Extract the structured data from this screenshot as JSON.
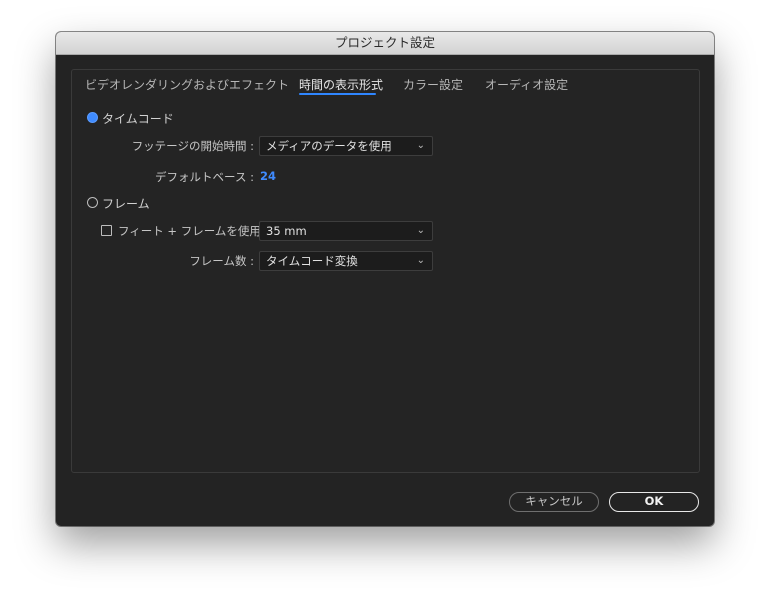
{
  "window": {
    "title": "プロジェクト設定"
  },
  "tabs": [
    {
      "label": "ビデオレンダリングおよびエフェクト",
      "active": false
    },
    {
      "label": "時間の表示形式",
      "active": true
    },
    {
      "label": "カラー設定",
      "active": false
    },
    {
      "label": "オーディオ設定",
      "active": false
    }
  ],
  "timecode": {
    "label": "タイムコード",
    "selected": true,
    "footage_start_label": "フッテージの開始時間 :",
    "footage_start_value": "メディアのデータを使用",
    "default_base_label": "デフォルトベース :",
    "default_base_value": "24"
  },
  "frames": {
    "label": "フレーム",
    "selected": false,
    "feet_frames_label": "フィート + フレームを使用 :",
    "feet_frames_checked": false,
    "feet_frames_value": "35 mm",
    "frame_count_label": "フレーム数 :",
    "frame_count_value": "タイムコード変換"
  },
  "buttons": {
    "cancel": "キャンセル",
    "ok": "OK"
  },
  "colors": {
    "accent": "#3f8bff",
    "window_bg": "#232323"
  },
  "icons": {
    "dropdown": "chevron-down-icon"
  }
}
